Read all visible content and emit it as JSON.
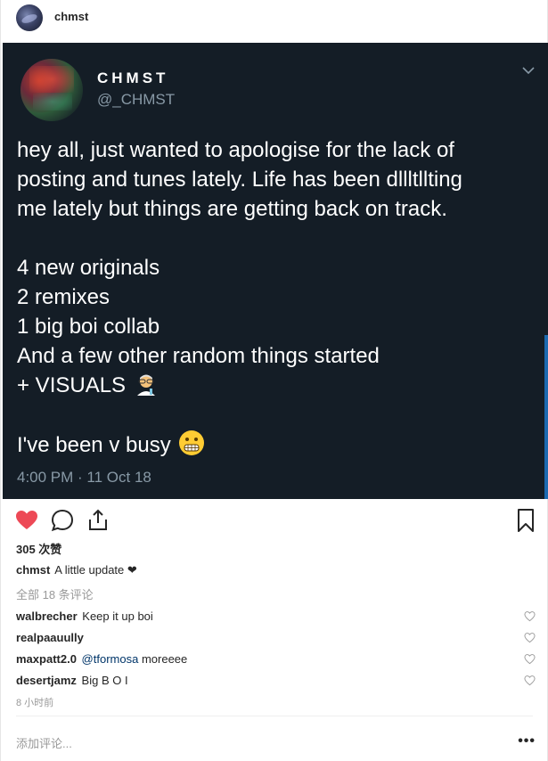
{
  "header": {
    "username": "chmst"
  },
  "tweet": {
    "display_name": "CHMST",
    "handle": "@_CHMST",
    "lines_1": [
      "hey all, just wanted to apologise for the lack of",
      "posting and tunes lately. Life has been dllltllting",
      "me lately but things are getting back on track."
    ],
    "lines_2": [
      "4 new originals",
      "2 remixes",
      "1 big boi collab",
      "And a few other random things started"
    ],
    "visuals_line": "+ VISUALS",
    "busy_line": "I've been v busy",
    "timestamp": "4:00 PM · 11 Oct 18"
  },
  "post": {
    "likes_text": "305 次赞",
    "caption_user": "chmst",
    "caption_text": "A little update ❤",
    "view_all_text": "全部 18 条评论",
    "comments": [
      {
        "user": "walbrecher",
        "mention": "",
        "text": "Keep it up boi"
      },
      {
        "user": "realpaauully",
        "mention": "",
        "text": ""
      },
      {
        "user": "maxpatt2.0",
        "mention": "@tformosa",
        "text": "moreeee"
      },
      {
        "user": "desertjamz",
        "mention": "",
        "text": "Big B O I"
      }
    ],
    "time_ago": "8 小时前",
    "add_comment_placeholder": "添加评论...",
    "more_label": "•••"
  },
  "icons": {
    "like": "heart-filled-icon",
    "comment": "comment-bubble-icon",
    "share": "share-icon",
    "save": "bookmark-icon",
    "comment_like": "heart-outline-icon",
    "tweet_menu": "chevron-down-icon"
  },
  "colors": {
    "tweet_bg": "#141d26",
    "like_red": "#ed4956",
    "muted": "#999999",
    "handle_gray": "#8899a6"
  }
}
